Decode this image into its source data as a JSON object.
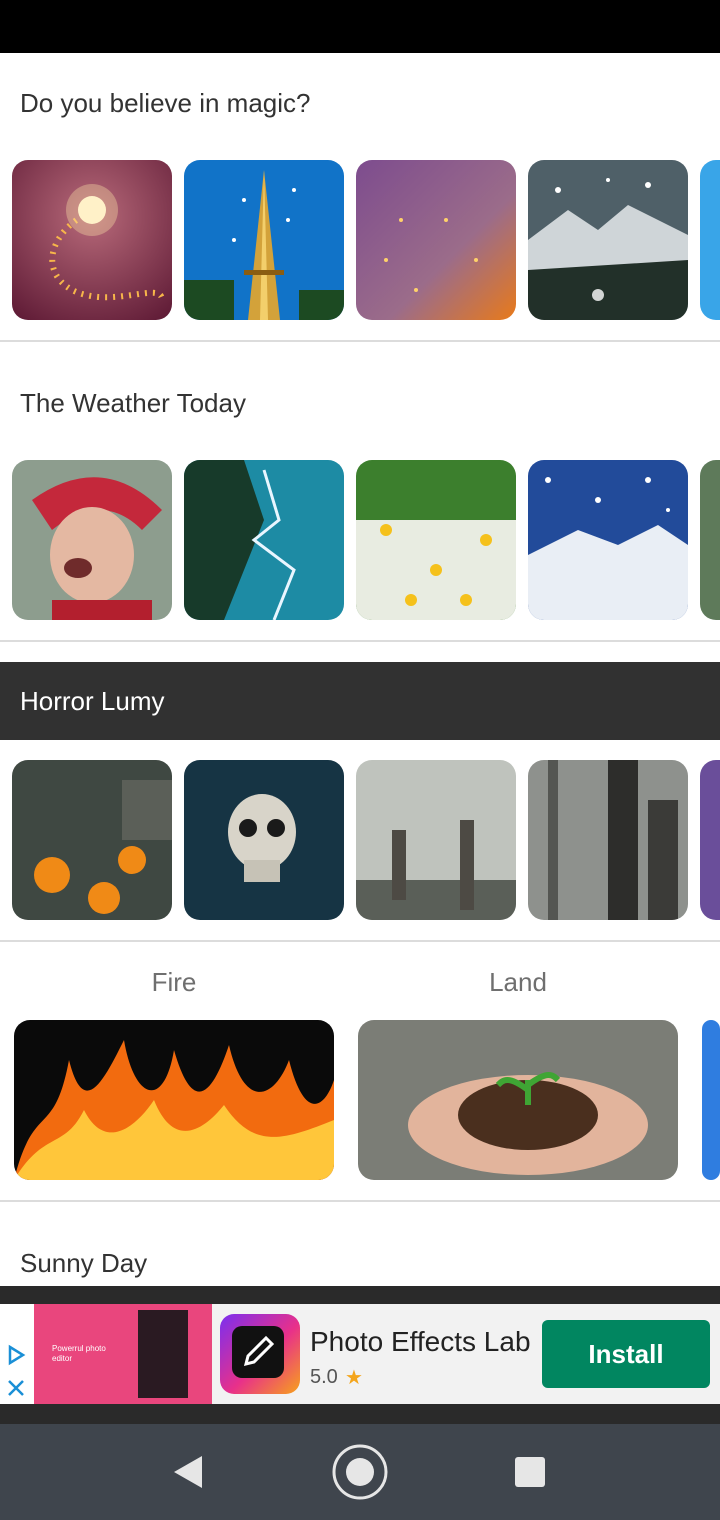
{
  "sections": {
    "magic": {
      "title": "Do you believe in magic?"
    },
    "weather": {
      "title": "The Weather Today"
    },
    "horror": {
      "title": "Horror Lumy"
    },
    "categories": {
      "fire": "Fire",
      "land": "Land"
    },
    "sunny": {
      "title": "Sunny Day"
    }
  },
  "ad": {
    "app_name": "Photo Effects Lab",
    "rating": "5.0",
    "install_label": "Install",
    "image_caption": "Powerrul photo editor",
    "close_icon": "close-icon",
    "adchoices_icon": "adchoices-icon"
  },
  "nav": {
    "back_icon": "back-triangle-icon",
    "home_icon": "home-circle-icon",
    "recents_icon": "recents-square-icon"
  },
  "colors": {
    "install_button": "#018660",
    "star": "#f4a51c",
    "dark_header": "#313131"
  }
}
